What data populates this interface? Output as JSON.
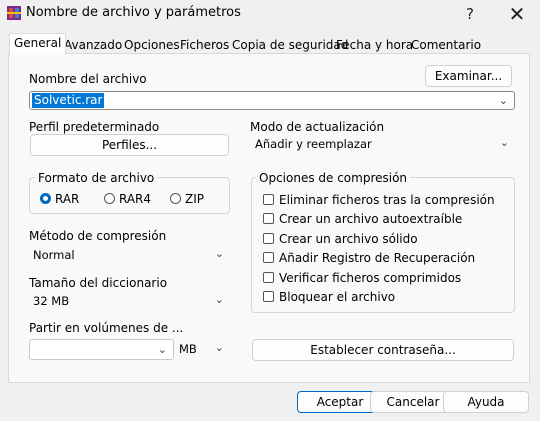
{
  "window": {
    "title": "Nombre de archivo y parámetros",
    "help": "?",
    "close": "✕"
  },
  "tabs": [
    {
      "label": "General",
      "active": true
    },
    {
      "label": "Avanzado"
    },
    {
      "label": "Opciones"
    },
    {
      "label": "Ficheros"
    },
    {
      "label": "Copia de seguridad"
    },
    {
      "label": "Fecha y hora"
    },
    {
      "label": "Comentario"
    }
  ],
  "archive_name": {
    "label": "Nombre del archivo",
    "value": "Solvetic.rar",
    "browse": "Examinar..."
  },
  "default_profile": {
    "label": "Perfil predeterminado",
    "button": "Perfiles..."
  },
  "update_mode": {
    "label": "Modo de actualización",
    "value": "Añadir y reemplazar"
  },
  "archive_format": {
    "legend": "Formato de archivo",
    "options": [
      {
        "label": "RAR",
        "checked": true
      },
      {
        "label": "RAR4",
        "checked": false
      },
      {
        "label": "ZIP",
        "checked": false
      }
    ]
  },
  "compression_method": {
    "label": "Método de compresión",
    "value": "Normal"
  },
  "dictionary_size": {
    "label": "Tamaño del diccionario",
    "value": "32 MB"
  },
  "split_volumes": {
    "label": "Partir en volúmenes de ...",
    "value": "",
    "unit": "MB"
  },
  "compression_options": {
    "legend": "Opciones de compresión",
    "items": [
      {
        "label": "Eliminar ficheros tras la compresión",
        "checked": false
      },
      {
        "label": "Crear un archivo autoextraíble",
        "checked": false
      },
      {
        "label": "Crear un archivo sólido",
        "checked": false
      },
      {
        "label": "Añadir Registro de Recuperación",
        "checked": false
      },
      {
        "label": "Verificar ficheros comprimidos",
        "checked": false
      },
      {
        "label": "Bloquear el archivo",
        "checked": false
      }
    ]
  },
  "set_password": "Establecer contraseña...",
  "footer": {
    "ok": "Aceptar",
    "cancel": "Cancelar",
    "help": "Ayuda"
  },
  "colors": {
    "accent": "#0067c0",
    "selection": "#0078d7",
    "background": "#f0f0f0"
  },
  "icons": {
    "app": "winrar-icon",
    "dropdown": "chevron-down-icon"
  }
}
